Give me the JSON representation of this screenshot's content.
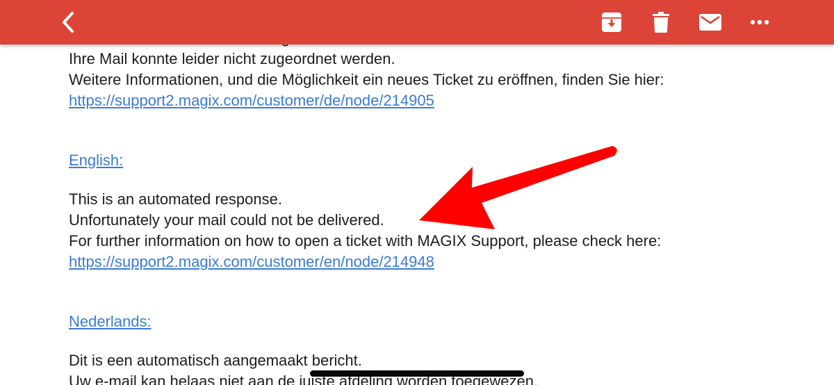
{
  "toolbar": {
    "background": "#dc4437",
    "icons": [
      "back-icon",
      "archive-icon",
      "trash-icon",
      "mail-icon",
      "more-icon"
    ]
  },
  "message": {
    "german": {
      "line1": "Dies ist eine automatisch erzeugte Nachricht.",
      "line2": "Ihre Mail konnte leider nicht zugeordnet werden.",
      "line3": "Weitere Informationen, und die Möglichkeit ein neues Ticket zu eröffnen, finden Sie hier:",
      "link": "https://support2.magix.com/customer/de/node/214905"
    },
    "english": {
      "heading": "English:",
      "line1": "This is an automated response.",
      "line2": "Unfortunately your mail could not be delivered.",
      "line3": "For further information on how to open a ticket with MAGIX Support, please check here:",
      "link": "https://support2.magix.com/customer/en/node/214948"
    },
    "dutch": {
      "heading": "Nederlands:",
      "line1": "Dit is een automatisch aangemaakt bericht.",
      "line2": "Uw e-mail kan helaas niet aan de juiste afdeling worden toegewezen."
    }
  },
  "annotation": {
    "arrow_color": "#ff0000"
  }
}
